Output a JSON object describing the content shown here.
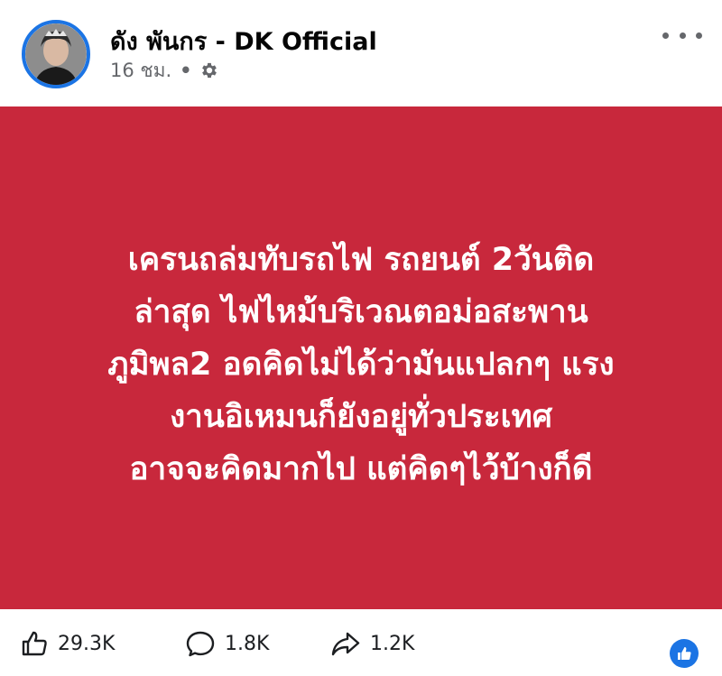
{
  "post": {
    "author": "ดัง พันกร - DK Official",
    "time": "16 ชม.",
    "separator": "•",
    "privacy_icon": "gear-icon",
    "more_icon": "more-dots-icon"
  },
  "card": {
    "background_color": "#c8283c",
    "lines": [
      "เครนถล่มทับรถไฟ รถยนต์ 2วันติด",
      "ล่าสุด ไฟไหม้บริเวณตอม่อสะพาน",
      "ภูมิพล2 อดคิดไม่ได้ว่ามันแปลกๆ แรง",
      "งานอิเหมนก็ยังอยู่ทั่วประเทศ",
      "อาจจะคิดมากไป แต่คิดๆไว้บ้างก็ดี"
    ]
  },
  "stats": {
    "likes": "29.3K",
    "comments": "1.8K",
    "shares": "1.2K",
    "like_icon": "thumbs-up-icon",
    "comment_icon": "comment-icon",
    "share_icon": "share-icon",
    "reaction_icon": "like-reaction-icon",
    "accent_color": "#1b74e4"
  }
}
